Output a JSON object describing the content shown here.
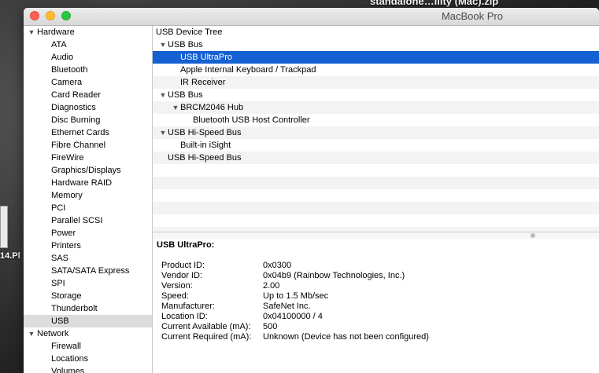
{
  "desktop": {
    "top_label": "standalone…ility (Mac).zip",
    "left_label": "14.Pl"
  },
  "window": {
    "title": "MacBook Pro"
  },
  "sidebar": {
    "items": [
      {
        "label": "Hardware",
        "kind": "cat"
      },
      {
        "label": "ATA",
        "kind": "item"
      },
      {
        "label": "Audio",
        "kind": "item"
      },
      {
        "label": "Bluetooth",
        "kind": "item"
      },
      {
        "label": "Camera",
        "kind": "item"
      },
      {
        "label": "Card Reader",
        "kind": "item"
      },
      {
        "label": "Diagnostics",
        "kind": "item"
      },
      {
        "label": "Disc Burning",
        "kind": "item"
      },
      {
        "label": "Ethernet Cards",
        "kind": "item"
      },
      {
        "label": "Fibre Channel",
        "kind": "item"
      },
      {
        "label": "FireWire",
        "kind": "item"
      },
      {
        "label": "Graphics/Displays",
        "kind": "item"
      },
      {
        "label": "Hardware RAID",
        "kind": "item"
      },
      {
        "label": "Memory",
        "kind": "item"
      },
      {
        "label": "PCI",
        "kind": "item"
      },
      {
        "label": "Parallel SCSI",
        "kind": "item"
      },
      {
        "label": "Power",
        "kind": "item"
      },
      {
        "label": "Printers",
        "kind": "item"
      },
      {
        "label": "SAS",
        "kind": "item"
      },
      {
        "label": "SATA/SATA Express",
        "kind": "item"
      },
      {
        "label": "SPI",
        "kind": "item"
      },
      {
        "label": "Storage",
        "kind": "item"
      },
      {
        "label": "Thunderbolt",
        "kind": "item"
      },
      {
        "label": "USB",
        "kind": "item",
        "selected": true
      },
      {
        "label": "Network",
        "kind": "cat"
      },
      {
        "label": "Firewall",
        "kind": "item"
      },
      {
        "label": "Locations",
        "kind": "item"
      },
      {
        "label": "Volumes",
        "kind": "item"
      }
    ]
  },
  "tree": {
    "header": "USB Device Tree",
    "rows": [
      {
        "label": "USB Bus",
        "level": 0,
        "expanded": true
      },
      {
        "label": "USB UltraPro",
        "level": 1,
        "selected": true
      },
      {
        "label": "Apple Internal Keyboard / Trackpad",
        "level": 1
      },
      {
        "label": "IR Receiver",
        "level": 1
      },
      {
        "label": "USB Bus",
        "level": 0,
        "expanded": true
      },
      {
        "label": "BRCM2046 Hub",
        "level": 1,
        "expanded": true
      },
      {
        "label": "Bluetooth USB Host Controller",
        "level": 2
      },
      {
        "label": "USB Hi-Speed Bus",
        "level": 0,
        "expanded": true
      },
      {
        "label": "Built-in iSight",
        "level": 1
      },
      {
        "label": "USB Hi-Speed Bus",
        "level": 0
      }
    ]
  },
  "detail": {
    "title": "USB UltraPro:",
    "fields": [
      {
        "key": "Product ID:",
        "value": "0x0300"
      },
      {
        "key": "Vendor ID:",
        "value": "0x04b9  (Rainbow Technologies, Inc.)"
      },
      {
        "key": "Version:",
        "value": "2.00"
      },
      {
        "key": "Speed:",
        "value": "Up to 1.5 Mb/sec"
      },
      {
        "key": "Manufacturer:",
        "value": "SafeNet Inc."
      },
      {
        "key": "Location ID:",
        "value": "0x04100000 / 4"
      },
      {
        "key": "Current Available (mA):",
        "value": "500"
      },
      {
        "key": "Current Required (mA):",
        "value": "Unknown (Device has not been configured)"
      }
    ]
  },
  "icons": {
    "expanded": "▼",
    "collapsed": "▶"
  },
  "colors": {
    "selection": "#1560d2",
    "sidebar_selection": "#dcdcdc"
  }
}
